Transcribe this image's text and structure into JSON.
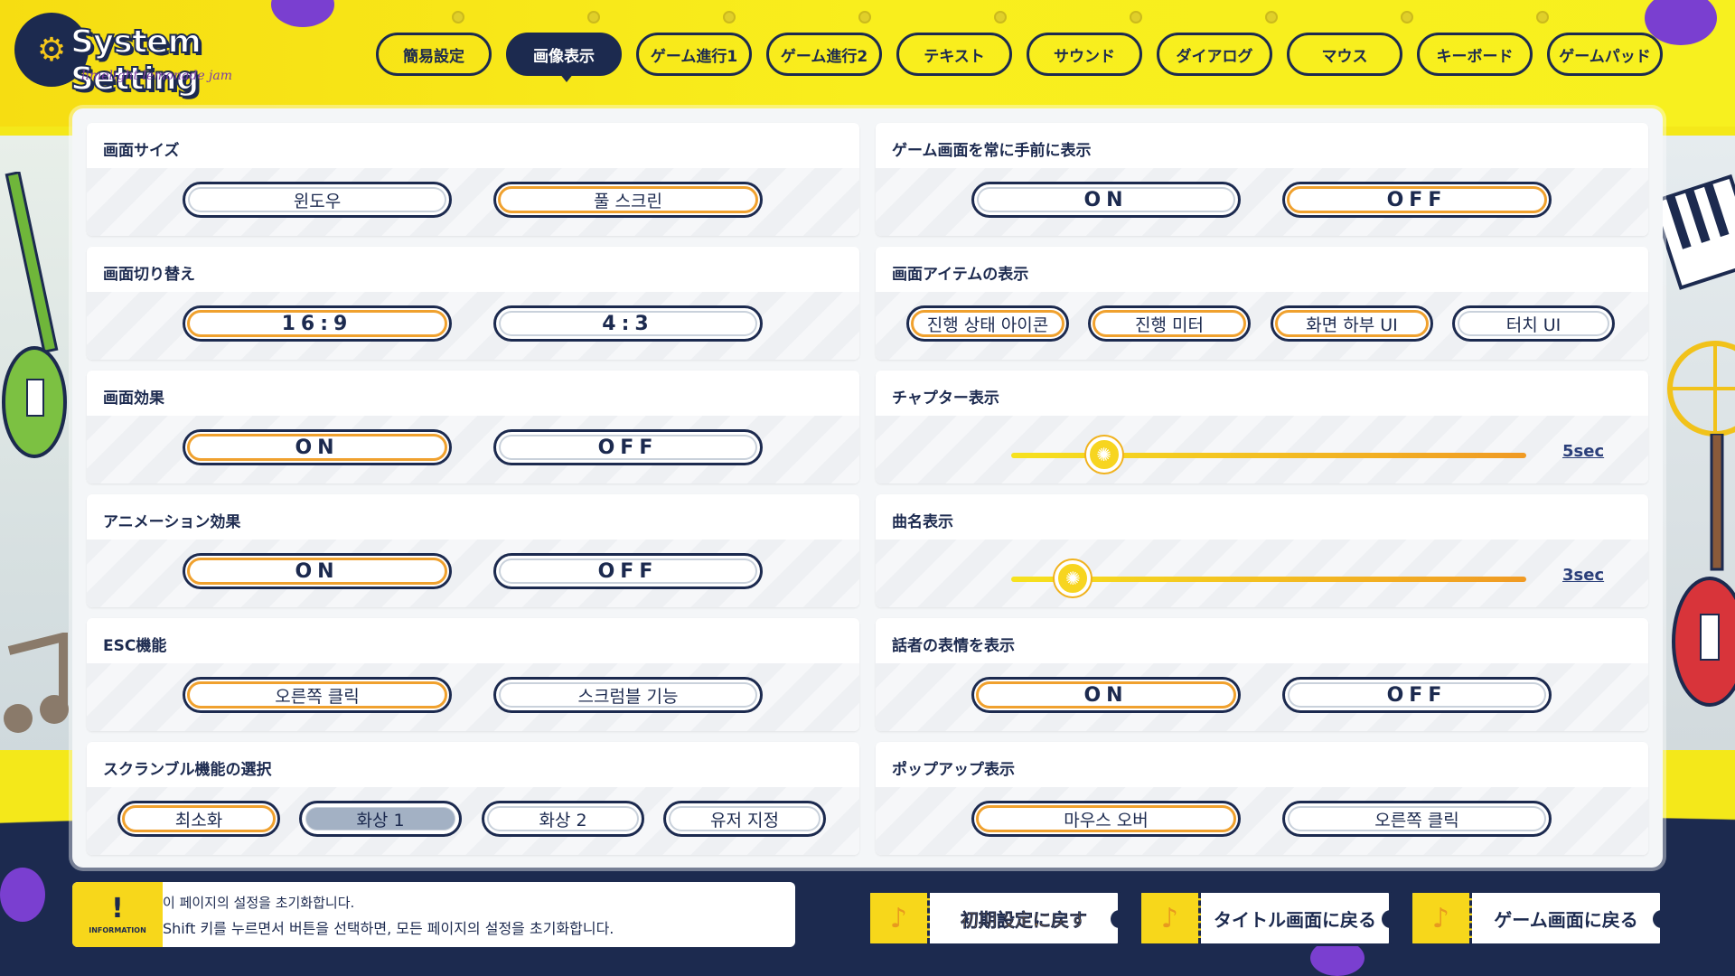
{
  "app": {
    "title": "System Setting",
    "subtitle": "limelight lemonade jam"
  },
  "tabs": [
    {
      "label": "簡易設定",
      "active": false
    },
    {
      "label": "画像表示",
      "active": true
    },
    {
      "label": "ゲーム進行1",
      "active": false
    },
    {
      "label": "ゲーム進行2",
      "active": false
    },
    {
      "label": "テキスト",
      "active": false
    },
    {
      "label": "サウンド",
      "active": false
    },
    {
      "label": "ダイアログ",
      "active": false
    },
    {
      "label": "マウス",
      "active": false
    },
    {
      "label": "キーボード",
      "active": false
    },
    {
      "label": "ゲームパッド",
      "active": false
    }
  ],
  "left": [
    {
      "title": "画面サイズ",
      "options": [
        {
          "label": "윈도우",
          "selected": false
        },
        {
          "label": "풀 스크린",
          "selected": true
        }
      ]
    },
    {
      "title": "画面切り替え",
      "options": [
        {
          "label": "16:9",
          "selected": true
        },
        {
          "label": "4:3",
          "selected": false
        }
      ]
    },
    {
      "title": "画面効果",
      "options": [
        {
          "label": "ON",
          "selected": true
        },
        {
          "label": "OFF",
          "selected": false
        }
      ]
    },
    {
      "title": "アニメーション効果",
      "options": [
        {
          "label": "ON",
          "selected": true
        },
        {
          "label": "OFF",
          "selected": false
        }
      ]
    },
    {
      "title": "ESC機能",
      "options": [
        {
          "label": "오른쪽 클릭",
          "selected": true
        },
        {
          "label": "스크럼블 기능",
          "selected": false
        }
      ]
    },
    {
      "title": "スクランブル機能の選択",
      "options": [
        {
          "label": "최소화",
          "selected": true
        },
        {
          "label": "화상 1",
          "selected": false,
          "hover": true
        },
        {
          "label": "화상 2",
          "selected": false
        },
        {
          "label": "유저 지정",
          "selected": false
        }
      ]
    }
  ],
  "right": [
    {
      "title": "ゲーム画面を常に手前に表示",
      "options": [
        {
          "label": "ON",
          "selected": false
        },
        {
          "label": "OFF",
          "selected": true
        }
      ]
    },
    {
      "title": "画面アイテムの表示",
      "options": [
        {
          "label": "진행 상태 아이콘",
          "selected": true
        },
        {
          "label": "진행 미터",
          "selected": true
        },
        {
          "label": "화면 하부 UI",
          "selected": true
        },
        {
          "label": "터치 UI",
          "selected": false
        }
      ]
    },
    {
      "title": "チャプター表示",
      "slider": {
        "value_label": "5sec",
        "fraction": 0.18
      }
    },
    {
      "title": "曲名表示",
      "slider": {
        "value_label": "3sec",
        "fraction": 0.12
      }
    },
    {
      "title": "話者の表情を表示",
      "options": [
        {
          "label": "ON",
          "selected": true
        },
        {
          "label": "OFF",
          "selected": false
        }
      ]
    },
    {
      "title": "ポップアップ表示",
      "options": [
        {
          "label": "마우스 오버",
          "selected": true
        },
        {
          "label": "오른쪽 클릭",
          "selected": false
        }
      ]
    }
  ],
  "info": {
    "badge_label": "INFORMATION",
    "line1": "이 페이지의 설정을 초기화합니다.",
    "line2": "Shift 키를 누르면서 버튼을 선택하면, 모든 페이지의 설정을 초기화합니다."
  },
  "bottom_buttons": [
    {
      "label": "初期設定に戻す"
    },
    {
      "label": "タイトル画面に戻る"
    },
    {
      "label": "ゲーム画面に戻る"
    }
  ],
  "colors": {
    "navy": "#1c2a4f",
    "yellow": "#f4e81a",
    "orange": "#f1a431"
  }
}
